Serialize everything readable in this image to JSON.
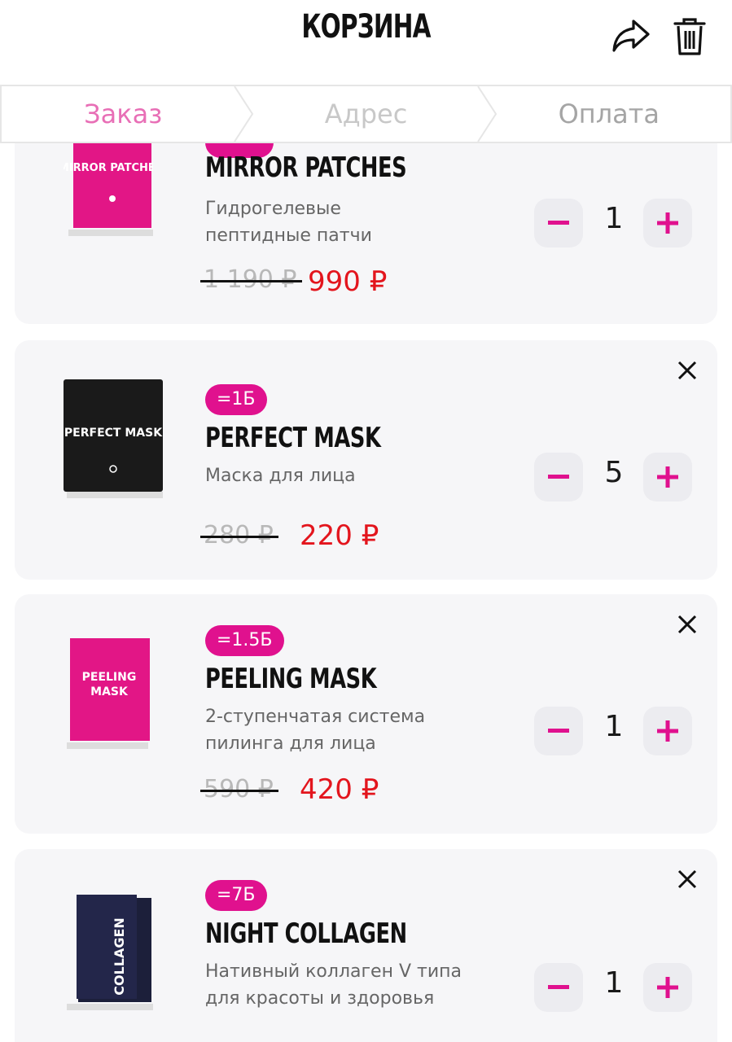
{
  "header": {
    "title": "КОРЗИНА",
    "share_icon": "share-arrow-icon",
    "trash_icon": "trash-icon"
  },
  "steps": [
    {
      "label": "Заказ",
      "state": "active"
    },
    {
      "label": "Адрес",
      "state": "inactive"
    },
    {
      "label": "Оплата",
      "state": "inactive"
    }
  ],
  "colors": {
    "accent": "#e0118e",
    "step_active": "#e86fb6",
    "price_new": "#e3151d",
    "card_bg": "#f6f6f8"
  },
  "items": [
    {
      "name": "MIRROR PATCHES",
      "badge": "",
      "description": "Гидрогелевые пептидные патчи",
      "old_price": "1 190 ₽",
      "new_price": "990 ₽",
      "quantity": "1",
      "thumb_text": "MIRROR PATCHES"
    },
    {
      "name": "PERFECT MASK",
      "badge": "=1Б",
      "description": "Маска для лица",
      "old_price": "280 ₽",
      "new_price": "220 ₽",
      "quantity": "5",
      "thumb_text": "PERFECT MASK"
    },
    {
      "name": "PEELING MASK",
      "badge": "=1.5Б",
      "description": "2-ступенчатая система пилинга для лица",
      "old_price": "590 ₽",
      "new_price": "420 ₽",
      "quantity": "1",
      "thumb_text": "PEELING MASK"
    },
    {
      "name": "NIGHT COLLAGEN",
      "badge": "=7Б",
      "description": "Нативный коллаген V типа для красоты и здоровья",
      "old_price": "",
      "new_price": "",
      "quantity": "1",
      "thumb_text": "COLLAGEN"
    }
  ]
}
